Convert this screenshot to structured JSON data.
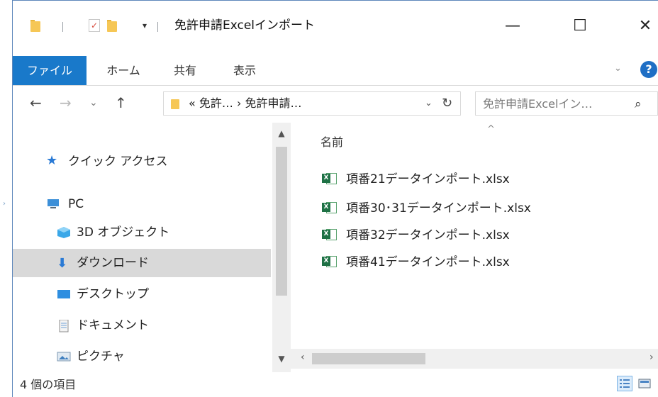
{
  "window": {
    "title": "免許申請Excelインポート",
    "quick_access_dropdown": "▾",
    "minimize": "—",
    "maximize": "☐",
    "close": "✕"
  },
  "ribbon": {
    "tabs": [
      {
        "label": "ファイル",
        "active": true
      },
      {
        "label": "ホーム"
      },
      {
        "label": "共有"
      },
      {
        "label": "表示"
      }
    ],
    "chevron": "⌄",
    "help": "?"
  },
  "nav": {
    "back": "←",
    "forward": "→",
    "recent": "⌄",
    "up": "↑"
  },
  "address": {
    "path_text": "« 免許… › 免許申請…",
    "dropdown": "⌄",
    "refresh": "↻"
  },
  "search": {
    "placeholder": "免許申請Excelイン…",
    "icon": "⌕"
  },
  "navpane": {
    "items": [
      {
        "label": "クイック アクセス",
        "icon": "star-icon"
      },
      {
        "label": "PC",
        "icon": "pc-icon"
      },
      {
        "label": "3D オブジェクト",
        "icon": "3d-objects-icon"
      },
      {
        "label": "ダウンロード",
        "icon": "download-icon",
        "selected": true
      },
      {
        "label": "デスクトップ",
        "icon": "desktop-icon"
      },
      {
        "label": "ドキュメント",
        "icon": "documents-icon"
      },
      {
        "label": "ピクチャ",
        "icon": "pictures-icon"
      }
    ]
  },
  "content": {
    "column_name": "名前",
    "sort_indicator": "^",
    "files": [
      {
        "name": "項番21データインポート.xlsx"
      },
      {
        "name": "項番30･31データインポート.xlsx"
      },
      {
        "name": "項番32データインポート.xlsx"
      },
      {
        "name": "項番41データインポート.xlsx"
      }
    ]
  },
  "status": {
    "item_count": "4 個の項目"
  },
  "colors": {
    "accent": "#1979ca",
    "selected_nav": "#d9d9d9",
    "folder": "#f6c756",
    "excel": "#1e7145"
  }
}
